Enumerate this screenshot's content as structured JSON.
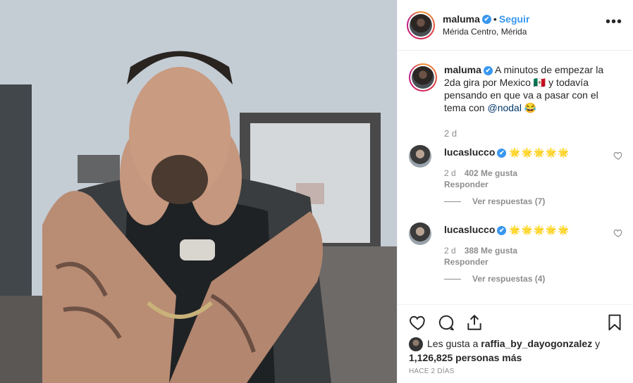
{
  "post": {
    "username": "maluma",
    "verified_mark": "✔",
    "separator": "•",
    "follow_label": "Seguir",
    "location": "Mérida Centro, Mérida",
    "more_label": "•••"
  },
  "caption": {
    "username": "maluma",
    "text_part1": "A minutos de empezar la 2da gira por Mexico 🇲🇽 y todavía pensando en que va a pasar con el tema con ",
    "mention": "@nodal",
    "text_part2": " 😂",
    "time": "2 d"
  },
  "comments": [
    {
      "username": "lucaslucco",
      "text": "🌟🌟🌟🌟🌟",
      "time": "2 d",
      "likes": "402 Me gusta",
      "reply_label": "Responder",
      "view_replies": "Ver respuestas (7)"
    },
    {
      "username": "lucaslucco",
      "text": "🌟🌟🌟🌟🌟",
      "time": "2 d",
      "likes": "388 Me gusta",
      "reply_label": "Responder",
      "view_replies": "Ver respuestas (4)"
    }
  ],
  "likes": {
    "prefix": "Les gusta a ",
    "user": "raffia_by_dayogonzalez",
    "connector": " y",
    "count": "1,126,825 personas más"
  },
  "timestamp": "HACE 2 DÍAS",
  "icons": {
    "like": "heart-icon",
    "comment": "comment-icon",
    "share": "share-icon",
    "save": "bookmark-icon",
    "options": "more-icon"
  },
  "colors": {
    "link_blue": "#3897f0",
    "mention_blue": "#00376b",
    "muted": "#8e8e8e",
    "text": "#262626"
  }
}
